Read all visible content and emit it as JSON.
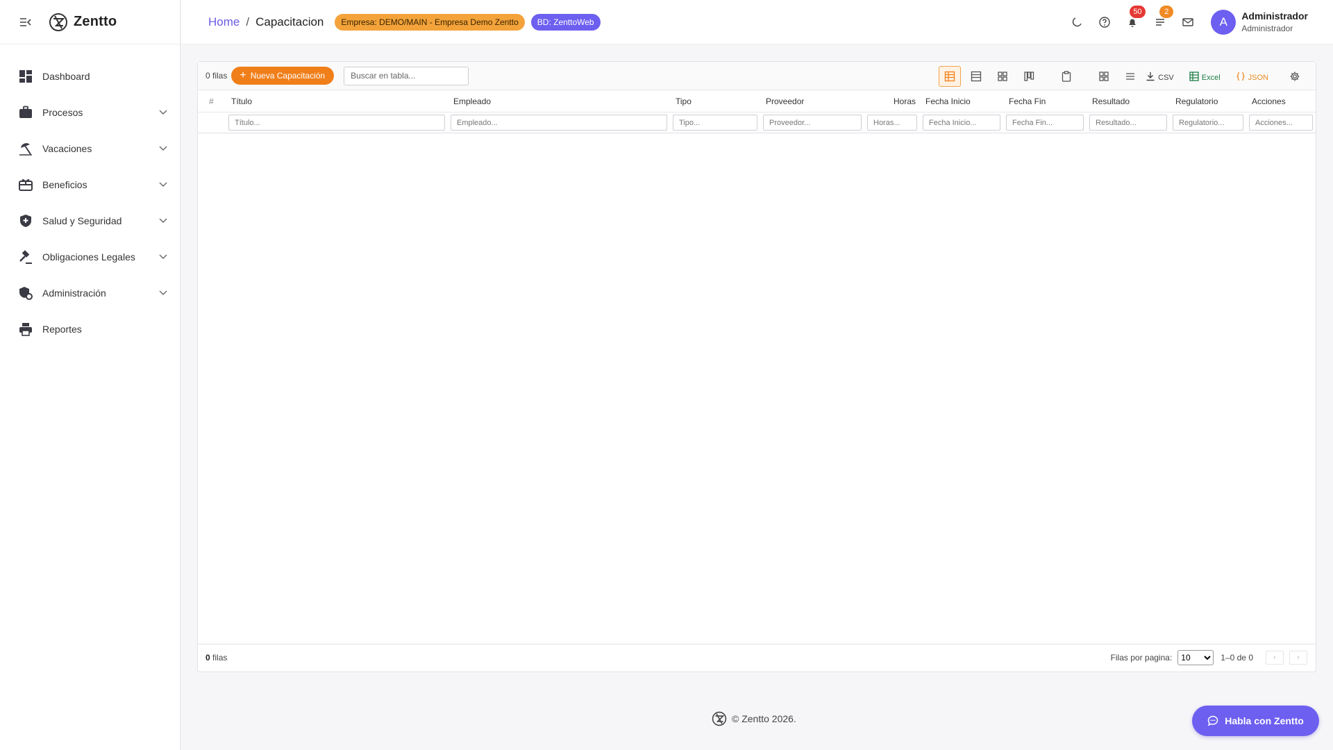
{
  "app": {
    "name": "Zentto",
    "colors": {
      "accent": "#6d5ff0",
      "primary_button": "#f07f1a",
      "company_chip": "#f3a33a",
      "notif_badge": "#e53935",
      "tasks_badge": "#f08a24"
    }
  },
  "sidebar": {
    "items": [
      {
        "label": "Dashboard",
        "icon": "dashboard-icon",
        "has_children": false
      },
      {
        "label": "Procesos",
        "icon": "briefcase-icon",
        "has_children": true
      },
      {
        "label": "Vacaciones",
        "icon": "beach-icon",
        "has_children": true
      },
      {
        "label": "Beneficios",
        "icon": "gift-card-icon",
        "has_children": true
      },
      {
        "label": "Salud y Seguridad",
        "icon": "shield-plus-icon",
        "has_children": true
      },
      {
        "label": "Obligaciones Legales",
        "icon": "gavel-icon",
        "has_children": true
      },
      {
        "label": "Administración",
        "icon": "admin-settings-icon",
        "has_children": true
      },
      {
        "label": "Reportes",
        "icon": "printer-icon",
        "has_children": false
      }
    ]
  },
  "header": {
    "breadcrumb": {
      "home": "Home",
      "separator": "/",
      "current": "Capacitacion"
    },
    "company_chip": "Empresa: DEMO/MAIN - Empresa Demo Zentto",
    "db_chip": "BD: ZenttoWeb",
    "notifications_count": "50",
    "tasks_count": "2",
    "user": {
      "initial": "A",
      "name": "Administrador",
      "role": "Administrador"
    }
  },
  "toolbar": {
    "row_count": "0 filas",
    "new_button": "Nueva Capacitación",
    "new_button_icon": "+",
    "search_placeholder": "Buscar en tabla...",
    "export_csv": "CSV",
    "export_excel": "Excel",
    "export_json": "JSON"
  },
  "table": {
    "columns": [
      {
        "header": "#",
        "filter": ""
      },
      {
        "header": "Título",
        "filter": "Título..."
      },
      {
        "header": "Empleado",
        "filter": "Empleado..."
      },
      {
        "header": "Tipo",
        "filter": "Tipo..."
      },
      {
        "header": "Proveedor",
        "filter": "Proveedor..."
      },
      {
        "header": "Horas",
        "filter": "Horas..."
      },
      {
        "header": "Fecha Inicio",
        "filter": "Fecha Inicio..."
      },
      {
        "header": "Fecha Fin",
        "filter": "Fecha Fin..."
      },
      {
        "header": "Resultado",
        "filter": "Resultado..."
      },
      {
        "header": "Regulatorio",
        "filter": "Regulatorio..."
      },
      {
        "header": "Acciones",
        "filter": "Acciones..."
      }
    ],
    "rows": []
  },
  "pagination": {
    "count_number": "0",
    "count_label": "filas",
    "per_page_label": "Filas por pagina:",
    "per_page_value": "10",
    "range": "1–0 de 0",
    "prev": "‹",
    "next": "›"
  },
  "footer": {
    "copyright": "© Zentto 2026.",
    "chat_button": "Habla con Zentto"
  }
}
